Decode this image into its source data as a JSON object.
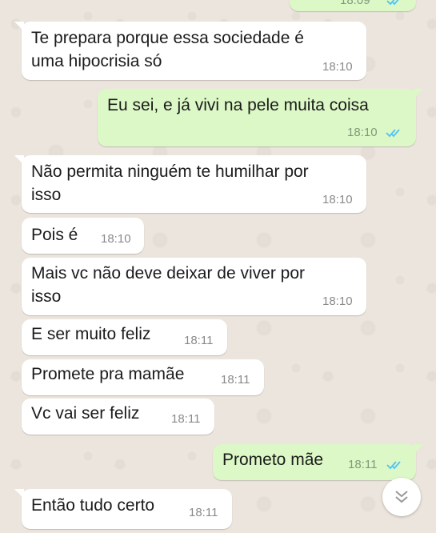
{
  "messages": [
    {
      "direction": "outgoing",
      "text": "",
      "time": "18:09",
      "ticks": "read"
    },
    {
      "direction": "incoming",
      "text": "Te prepara porque essa sociedade é\numa hipocrisia só",
      "time": "18:10"
    },
    {
      "direction": "outgoing",
      "text": "Eu sei, e já vivi na pele muita coisa",
      "time": "18:10",
      "ticks": "read"
    },
    {
      "direction": "incoming",
      "text": "Não permita ninguém te humilhar por\nisso",
      "time": "18:10"
    },
    {
      "direction": "incoming",
      "text": "Pois é",
      "time": "18:10"
    },
    {
      "direction": "incoming",
      "text": "Mais vc não deve deixar de viver por\nisso",
      "time": "18:10"
    },
    {
      "direction": "incoming",
      "text": "E ser muito feliz",
      "time": "18:11"
    },
    {
      "direction": "incoming",
      "text": "Promete pra mamãe",
      "time": "18:11"
    },
    {
      "direction": "incoming",
      "text": "Vc vai ser feliz",
      "time": "18:11"
    },
    {
      "direction": "outgoing",
      "text": "Prometo mãe",
      "time": "18:11",
      "ticks": "read"
    },
    {
      "direction": "incoming",
      "text": "Então tudo certo",
      "time": "18:11"
    }
  ],
  "colors": {
    "wallpaper": "#ece5dd",
    "incoming_bubble": "#ffffff",
    "outgoing_bubble": "#dcf8c6",
    "read_ticks": "#4fc3f7",
    "timestamp": "#8a8a8a"
  },
  "icons": {
    "read_receipt": "double-check-icon",
    "scroll_down": "chevron-double-down-icon"
  }
}
